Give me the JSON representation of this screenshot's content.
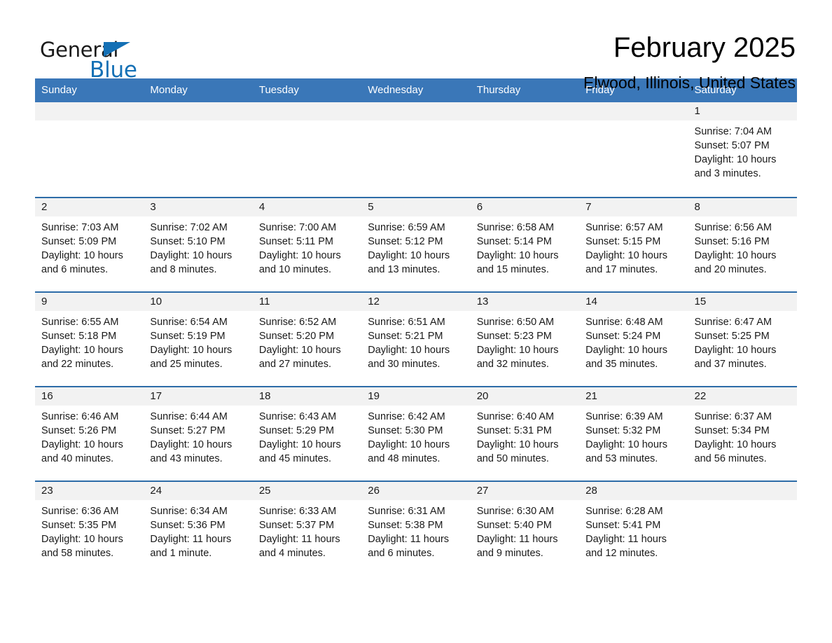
{
  "brand": {
    "name_part1": "General",
    "name_part2": "Blue",
    "accent_color": "#1470b5",
    "flag_icon": "triangle-flag-icon"
  },
  "header": {
    "month_title": "February 2025",
    "location": "Elwood, Illinois, United States"
  },
  "calendar": {
    "header_bg": "#3a77b8",
    "row_rule_color": "#2d6ca8",
    "daynum_band_bg": "#f2f2f2",
    "weekday_headers": [
      "Sunday",
      "Monday",
      "Tuesday",
      "Wednesday",
      "Thursday",
      "Friday",
      "Saturday"
    ],
    "weeks": [
      [
        {
          "day": "",
          "sunrise": "",
          "sunset": "",
          "daylight": "",
          "blank": true
        },
        {
          "day": "",
          "sunrise": "",
          "sunset": "",
          "daylight": "",
          "blank": true
        },
        {
          "day": "",
          "sunrise": "",
          "sunset": "",
          "daylight": "",
          "blank": true
        },
        {
          "day": "",
          "sunrise": "",
          "sunset": "",
          "daylight": "",
          "blank": true
        },
        {
          "day": "",
          "sunrise": "",
          "sunset": "",
          "daylight": "",
          "blank": true
        },
        {
          "day": "",
          "sunrise": "",
          "sunset": "",
          "daylight": "",
          "blank": true
        },
        {
          "day": "1",
          "sunrise": "Sunrise: 7:04 AM",
          "sunset": "Sunset: 5:07 PM",
          "daylight": "Daylight: 10 hours and 3 minutes.",
          "blank": false
        }
      ],
      [
        {
          "day": "2",
          "sunrise": "Sunrise: 7:03 AM",
          "sunset": "Sunset: 5:09 PM",
          "daylight": "Daylight: 10 hours and 6 minutes.",
          "blank": false
        },
        {
          "day": "3",
          "sunrise": "Sunrise: 7:02 AM",
          "sunset": "Sunset: 5:10 PM",
          "daylight": "Daylight: 10 hours and 8 minutes.",
          "blank": false
        },
        {
          "day": "4",
          "sunrise": "Sunrise: 7:00 AM",
          "sunset": "Sunset: 5:11 PM",
          "daylight": "Daylight: 10 hours and 10 minutes.",
          "blank": false
        },
        {
          "day": "5",
          "sunrise": "Sunrise: 6:59 AM",
          "sunset": "Sunset: 5:12 PM",
          "daylight": "Daylight: 10 hours and 13 minutes.",
          "blank": false
        },
        {
          "day": "6",
          "sunrise": "Sunrise: 6:58 AM",
          "sunset": "Sunset: 5:14 PM",
          "daylight": "Daylight: 10 hours and 15 minutes.",
          "blank": false
        },
        {
          "day": "7",
          "sunrise": "Sunrise: 6:57 AM",
          "sunset": "Sunset: 5:15 PM",
          "daylight": "Daylight: 10 hours and 17 minutes.",
          "blank": false
        },
        {
          "day": "8",
          "sunrise": "Sunrise: 6:56 AM",
          "sunset": "Sunset: 5:16 PM",
          "daylight": "Daylight: 10 hours and 20 minutes.",
          "blank": false
        }
      ],
      [
        {
          "day": "9",
          "sunrise": "Sunrise: 6:55 AM",
          "sunset": "Sunset: 5:18 PM",
          "daylight": "Daylight: 10 hours and 22 minutes.",
          "blank": false
        },
        {
          "day": "10",
          "sunrise": "Sunrise: 6:54 AM",
          "sunset": "Sunset: 5:19 PM",
          "daylight": "Daylight: 10 hours and 25 minutes.",
          "blank": false
        },
        {
          "day": "11",
          "sunrise": "Sunrise: 6:52 AM",
          "sunset": "Sunset: 5:20 PM",
          "daylight": "Daylight: 10 hours and 27 minutes.",
          "blank": false
        },
        {
          "day": "12",
          "sunrise": "Sunrise: 6:51 AM",
          "sunset": "Sunset: 5:21 PM",
          "daylight": "Daylight: 10 hours and 30 minutes.",
          "blank": false
        },
        {
          "day": "13",
          "sunrise": "Sunrise: 6:50 AM",
          "sunset": "Sunset: 5:23 PM",
          "daylight": "Daylight: 10 hours and 32 minutes.",
          "blank": false
        },
        {
          "day": "14",
          "sunrise": "Sunrise: 6:48 AM",
          "sunset": "Sunset: 5:24 PM",
          "daylight": "Daylight: 10 hours and 35 minutes.",
          "blank": false
        },
        {
          "day": "15",
          "sunrise": "Sunrise: 6:47 AM",
          "sunset": "Sunset: 5:25 PM",
          "daylight": "Daylight: 10 hours and 37 minutes.",
          "blank": false
        }
      ],
      [
        {
          "day": "16",
          "sunrise": "Sunrise: 6:46 AM",
          "sunset": "Sunset: 5:26 PM",
          "daylight": "Daylight: 10 hours and 40 minutes.",
          "blank": false
        },
        {
          "day": "17",
          "sunrise": "Sunrise: 6:44 AM",
          "sunset": "Sunset: 5:27 PM",
          "daylight": "Daylight: 10 hours and 43 minutes.",
          "blank": false
        },
        {
          "day": "18",
          "sunrise": "Sunrise: 6:43 AM",
          "sunset": "Sunset: 5:29 PM",
          "daylight": "Daylight: 10 hours and 45 minutes.",
          "blank": false
        },
        {
          "day": "19",
          "sunrise": "Sunrise: 6:42 AM",
          "sunset": "Sunset: 5:30 PM",
          "daylight": "Daylight: 10 hours and 48 minutes.",
          "blank": false
        },
        {
          "day": "20",
          "sunrise": "Sunrise: 6:40 AM",
          "sunset": "Sunset: 5:31 PM",
          "daylight": "Daylight: 10 hours and 50 minutes.",
          "blank": false
        },
        {
          "day": "21",
          "sunrise": "Sunrise: 6:39 AM",
          "sunset": "Sunset: 5:32 PM",
          "daylight": "Daylight: 10 hours and 53 minutes.",
          "blank": false
        },
        {
          "day": "22",
          "sunrise": "Sunrise: 6:37 AM",
          "sunset": "Sunset: 5:34 PM",
          "daylight": "Daylight: 10 hours and 56 minutes.",
          "blank": false
        }
      ],
      [
        {
          "day": "23",
          "sunrise": "Sunrise: 6:36 AM",
          "sunset": "Sunset: 5:35 PM",
          "daylight": "Daylight: 10 hours and 58 minutes.",
          "blank": false
        },
        {
          "day": "24",
          "sunrise": "Sunrise: 6:34 AM",
          "sunset": "Sunset: 5:36 PM",
          "daylight": "Daylight: 11 hours and 1 minute.",
          "blank": false
        },
        {
          "day": "25",
          "sunrise": "Sunrise: 6:33 AM",
          "sunset": "Sunset: 5:37 PM",
          "daylight": "Daylight: 11 hours and 4 minutes.",
          "blank": false
        },
        {
          "day": "26",
          "sunrise": "Sunrise: 6:31 AM",
          "sunset": "Sunset: 5:38 PM",
          "daylight": "Daylight: 11 hours and 6 minutes.",
          "blank": false
        },
        {
          "day": "27",
          "sunrise": "Sunrise: 6:30 AM",
          "sunset": "Sunset: 5:40 PM",
          "daylight": "Daylight: 11 hours and 9 minutes.",
          "blank": false
        },
        {
          "day": "28",
          "sunrise": "Sunrise: 6:28 AM",
          "sunset": "Sunset: 5:41 PM",
          "daylight": "Daylight: 11 hours and 12 minutes.",
          "blank": false
        },
        {
          "day": "",
          "sunrise": "",
          "sunset": "",
          "daylight": "",
          "blank": true
        }
      ]
    ]
  }
}
